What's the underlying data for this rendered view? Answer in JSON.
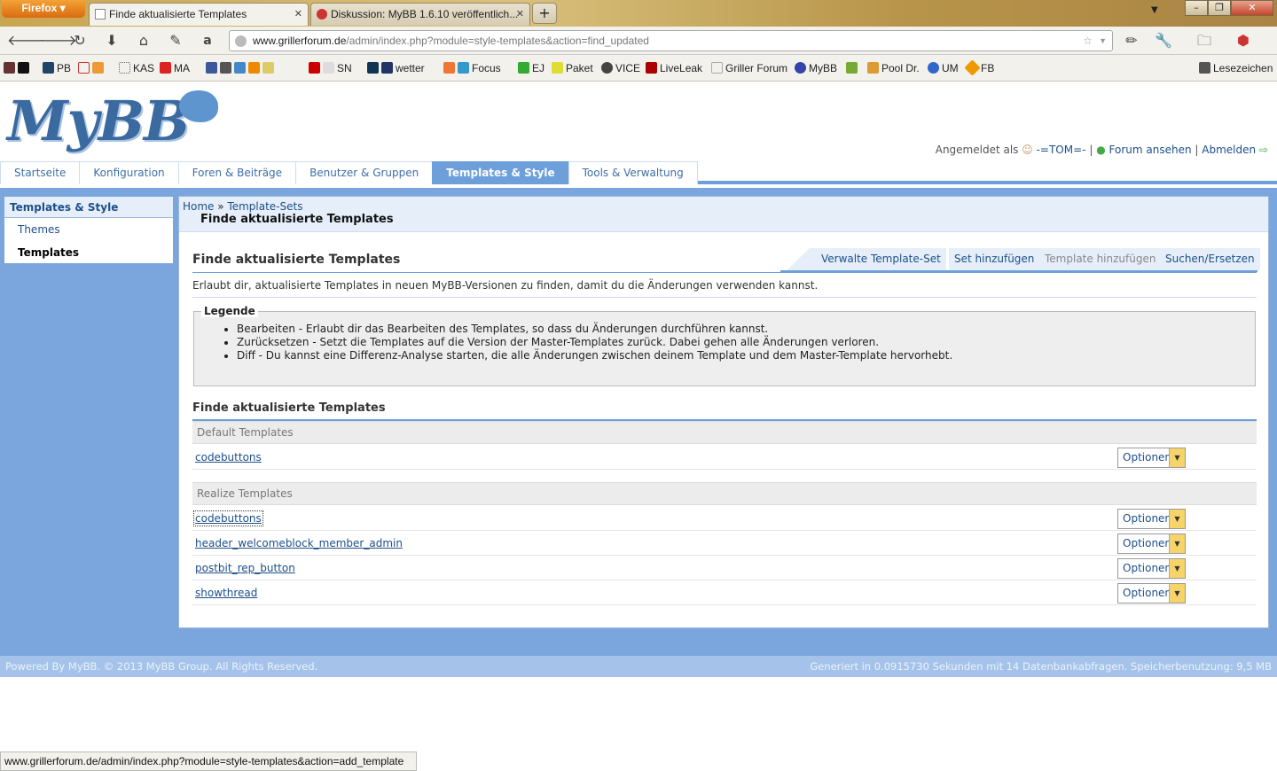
{
  "browser": {
    "app_button": "Firefox",
    "tabs": [
      {
        "label": "Finde aktualisierte Templates"
      },
      {
        "label": "Diskussion: MyBB 1.6.10 veröffentlich..."
      }
    ],
    "new_tab": "+",
    "url_domain": "www.grillerforum.de",
    "url_path": "/admin/index.php?module=style-templates&action=find_updated",
    "bookmarks": [
      "PB",
      "KAS",
      "MA",
      "SN",
      "wetter",
      "Focus",
      "EJ",
      "Paket",
      "VICE",
      "LiveLeak",
      "Griller Forum",
      "MyBB",
      "Pool Dr.",
      "UM",
      "FB"
    ],
    "bookmarks_menu": "Lesezeichen",
    "status_url": "www.grillerforum.de/admin/index.php?module=style-templates&action=add_template"
  },
  "header": {
    "logo": "MyBB",
    "logged_in_as": "Angemeldet als",
    "username": "-=TOM=-",
    "sep": "|",
    "view_forum": "Forum ansehen",
    "logout": "Abmelden"
  },
  "topnav": [
    {
      "label": "Startseite"
    },
    {
      "label": "Konfiguration"
    },
    {
      "label": "Foren & Beiträge"
    },
    {
      "label": "Benutzer & Gruppen"
    },
    {
      "label": "Templates & Style"
    },
    {
      "label": "Tools & Verwaltung"
    }
  ],
  "sidebar": {
    "title": "Templates & Style",
    "items": [
      {
        "label": "Themes"
      },
      {
        "label": "Templates"
      }
    ]
  },
  "breadcrumb": {
    "home": "Home",
    "sep": "»",
    "sets": "Template-Sets",
    "page_title": "Finde aktualisierte Templates"
  },
  "section": {
    "title": "Finde aktualisierte Templates",
    "subtabs": [
      {
        "label": "Verwalte Template-Set"
      },
      {
        "label": "Set hinzufügen"
      },
      {
        "label": "Template hinzufügen"
      },
      {
        "label": "Suchen/Ersetzen"
      }
    ],
    "description": "Erlaubt dir, aktualisierte Templates in neuen MyBB-Versionen zu finden, damit du die Änderungen verwenden kannst."
  },
  "legend": {
    "title": "Legende",
    "items": [
      "Bearbeiten - Erlaubt dir das Bearbeiten des Templates, so dass du Änderungen durchführen kannst.",
      "Zurücksetzen - Setzt die Templates auf die Version der Master-Templates zurück. Dabei gehen alle Änderungen verloren.",
      "Diff - Du kannst eine Differenz-Analyse starten, die alle Änderungen zwischen deinem Template und dem Master-Template hervorhebt."
    ]
  },
  "table": {
    "title": "Finde aktualisierte Templates",
    "groups": [
      {
        "name": "Default Templates",
        "rows": [
          "codebuttons"
        ]
      },
      {
        "name": "Realize Templates",
        "rows": [
          "codebuttons",
          "header_welcomeblock_member_admin",
          "postbit_rep_button",
          "showthread"
        ]
      }
    ],
    "options_label": "Optionen"
  },
  "footer": {
    "left": "Powered By MyBB. © 2013 MyBB Group. All Rights Reserved.",
    "right": "Generiert in 0.0915730 Sekunden mit 14 Datenbankabfragen. Speicherbenutzung: 9,5 MB"
  },
  "colors": {
    "accent": "#6d9fdb",
    "link": "#1c4f8a",
    "option_arrow": "#f6d469"
  }
}
